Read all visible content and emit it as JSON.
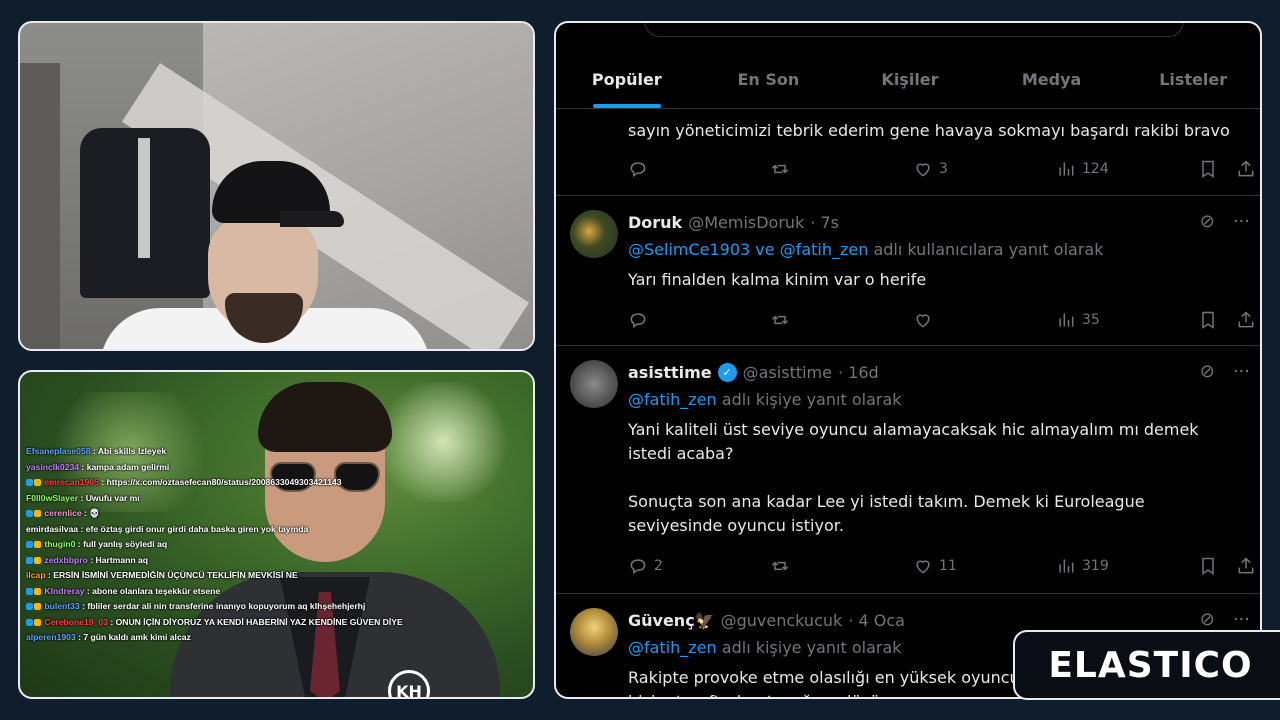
{
  "twitter": {
    "tabs": [
      {
        "label": "Popüler",
        "active": true
      },
      {
        "label": "En Son",
        "active": false
      },
      {
        "label": "Kişiler",
        "active": false
      },
      {
        "label": "Medya",
        "active": false
      },
      {
        "label": "Listeler",
        "active": false
      }
    ],
    "tweets": [
      {
        "text": "sayın yöneticimizi tebrik ederim gene havaya sokmayı başardı rakibi bravo",
        "replies": "",
        "retweets": "",
        "likes": "3",
        "views": "124"
      },
      {
        "name": "Doruk",
        "handle": "@MemisDoruk",
        "time": "· 7s",
        "reply_mention": "@SelimCe1903 ve @fatih_zen",
        "reply_suffix": "adlı kullanıcılara yanıt olarak",
        "text": "Yarı finalden kalma kinim var o herife",
        "replies": "",
        "retweets": "",
        "likes": "",
        "views": "35"
      },
      {
        "name": "asisttime",
        "handle": "@asisttime",
        "time": "· 16d",
        "verified": true,
        "reply_mention": "@fatih_zen",
        "reply_suffix": "adlı kişiye yanıt olarak",
        "text": "Yani kaliteli üst seviye oyuncu alamayacaksak hic almayalım mı demek\nistedi acaba?\n\nSonuçta son ana kadar Lee yi istedi takım. Demek ki Euroleague\nseviyesinde oyuncu istiyor.",
        "replies": "2",
        "retweets": "",
        "likes": "11",
        "views": "319"
      },
      {
        "name": "Güvenç🦅",
        "handle": "@guvenckucuk",
        "time": "· 4 Oca",
        "reply_mention": "@fatih_zen",
        "reply_suffix": "adlı kişiye yanıt olarak",
        "text": "Rakipte provoke etme olasılığı en yüksek oyuncu\nbizim taraftarları tuzağına düşürmen..."
      }
    ]
  },
  "chat": [
    {
      "user": "Efsaneplase058",
      "color": "#5aa0ff",
      "msg": "Abi skills lzleyek"
    },
    {
      "user": "yasinclk0234",
      "color": "#c17dff",
      "msg": "kampa adam gelirmi"
    },
    {
      "user": "emrecan1905",
      "color": "#ff3b3b",
      "msg": "https://x.com/oztasefecan80/status/2008633049303421143",
      "badges": true
    },
    {
      "user": "F0ll0wSlayer",
      "color": "#8cff5a",
      "msg": "Uwufu var mı"
    },
    {
      "user": "cerenlice",
      "color": "#ff8ad6",
      "msg": "💀",
      "badges": true
    },
    {
      "user": "emirdasilvaa",
      "color": "#ffffff",
      "msg": "efe öztaş girdi onur girdi daha baska giren yok taymda"
    },
    {
      "user": "thugin0",
      "color": "#8cff5a",
      "msg": "full yanlış söyledi aq",
      "badges": true
    },
    {
      "user": "zedxbbpro",
      "color": "#c17dff",
      "msg": "Hartmann aq",
      "badges": true
    },
    {
      "user": "ilcap",
      "color": "#ff9b3b",
      "msg": "ERSİN İSMİNİ VERMEDİĞİN ÜÇÜNCÜ TEKLİFİN MEVKİSİ NE"
    },
    {
      "user": "Klndreray",
      "color": "#c17dff",
      "msg": "abone olanlara teşekkür etsene",
      "badges": true
    },
    {
      "user": "bulent33",
      "color": "#5aa0ff",
      "msg": "fbliler serdar ali nin transferine inanıyo kopuyorum aq klhşehehjerhj",
      "badges": true
    },
    {
      "user": "Cerebone19_03",
      "color": "#ff3b3b",
      "msg": "ONUN İÇİN DİYORUZ YA KENDİ HABERİNİ YAZ KENDİNE GÜVEN DİYE",
      "badges": true
    },
    {
      "user": "alperen1903",
      "color": "#5aa0ff",
      "msg": "7 gün kaldı amk kimi alcaz"
    }
  ],
  "photo_logo": "KH",
  "brand": {
    "name": "ELASTICO"
  },
  "colors": {
    "accent": "#1d9bf0",
    "bg": "#0f1d2c"
  }
}
